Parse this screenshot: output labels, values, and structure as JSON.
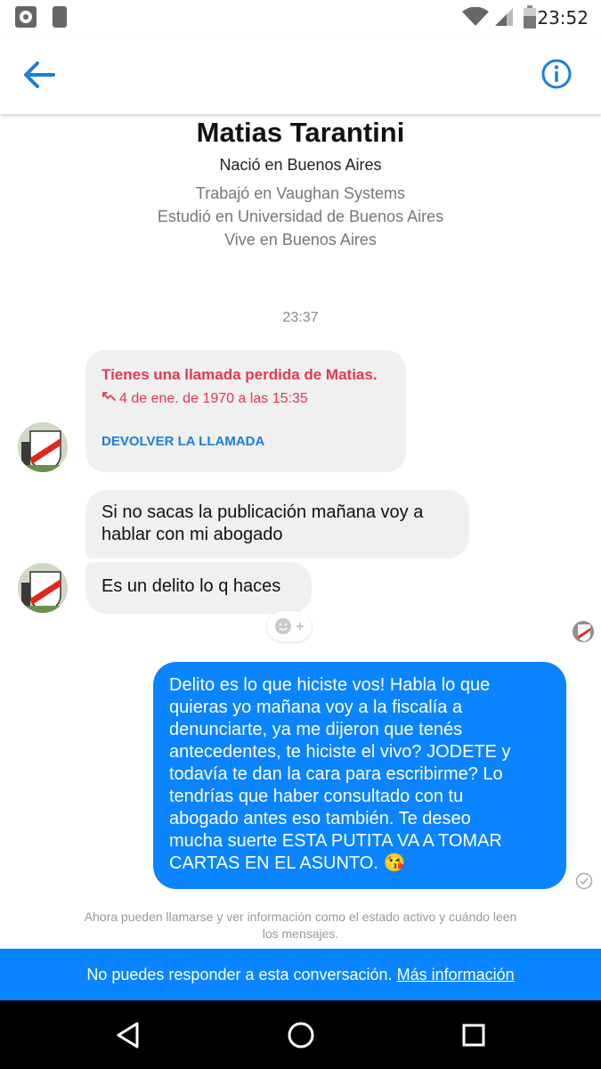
{
  "status_bar": {
    "time": "23:52"
  },
  "header": {
    "back_icon": "arrow-left-icon",
    "info_icon": "info-icon",
    "accent": "#1a7fd9"
  },
  "profile": {
    "name": "Matias Tarantini",
    "born": "Nació en Buenos Aires",
    "details": [
      "Trabajó en Vaughan Systems",
      "Estudió en Universidad de Buenos Aires",
      "Vive en Buenos Aires"
    ]
  },
  "conversation": {
    "timestamp": "23:37",
    "missed_call": {
      "title": "Tienes una llamada perdida de Matias.",
      "date": "4 de ene. de 1970 a las 15:35",
      "action": "DEVOLVER LA LLAMADA"
    },
    "incoming": [
      {
        "text": "Si no sacas la publicación mañana voy a hablar con mi abogado"
      },
      {
        "text": "Es un delito lo q haces"
      }
    ],
    "outgoing": {
      "lines": [
        "Delito es lo que hiciste vos! Habla lo que",
        "quieras yo mañana voy a la fiscalía a",
        "denunciarte, ya me dijeron que tenés",
        "antecedentes, te hiciste el vivo? JODETE y",
        "todavía te dan la cara para escribirme? Lo",
        "tendrías que haber consultado con tu",
        "abogado antes eso también. Te deseo",
        "mucha suerte ESTA PUTITA VA A TOMAR",
        "CARTAS EN EL ASUNTO. 😘"
      ],
      "bubble_color": "#0a84ff"
    },
    "footer_note": "Ahora pueden llamarse y ver información como el estado activo y cuándo leen los mensajes."
  },
  "banner": {
    "text": "No puedes responder a esta conversación.",
    "link": "Más información"
  },
  "nav": {
    "back": "nav-back-icon",
    "home": "nav-home-icon",
    "recents": "nav-recents-icon"
  }
}
